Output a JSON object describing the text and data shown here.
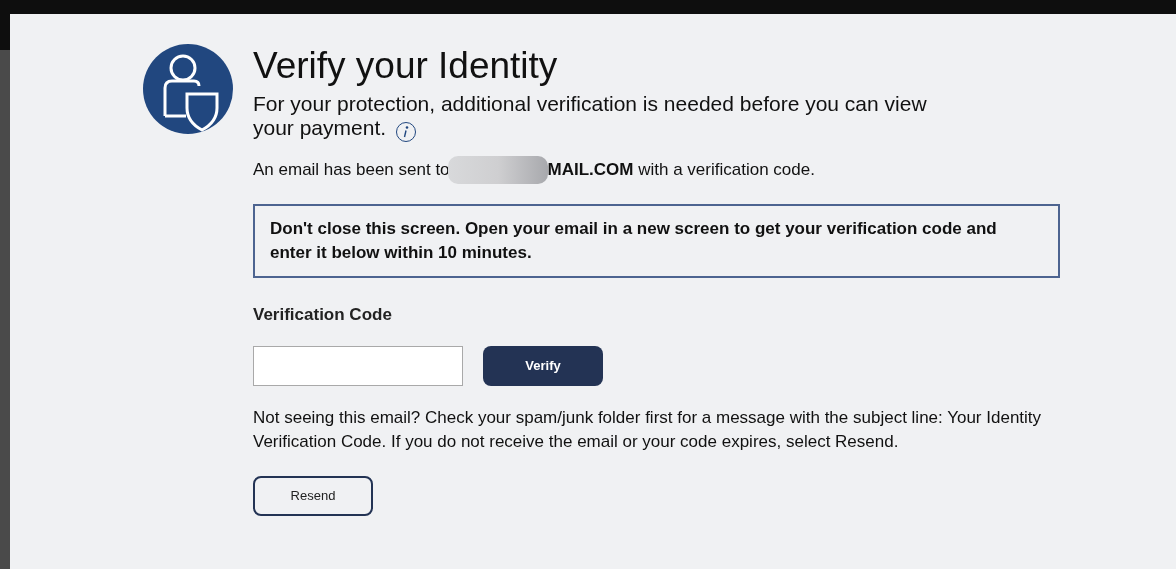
{
  "title": "Verify your Identity",
  "subtitle": "For your protection, additional verification is needed before you can view your payment.",
  "email_notice": {
    "before": "An email has been sent to",
    "after": "**MAIL.COM** with a verification code."
  },
  "warning": "Don't close this screen. Open your email in a new screen to get your verification code and enter it below within 10 minutes.",
  "code_field": {
    "label": "Verification Code"
  },
  "verify_button": "Verify",
  "help_text": "Not seeing this email? Check your spam/junk folder first for a message with the subject line: Your Identity Verification Code. If you do not receive the email or your code expires, select Resend.",
  "resend_button": "Resend"
}
